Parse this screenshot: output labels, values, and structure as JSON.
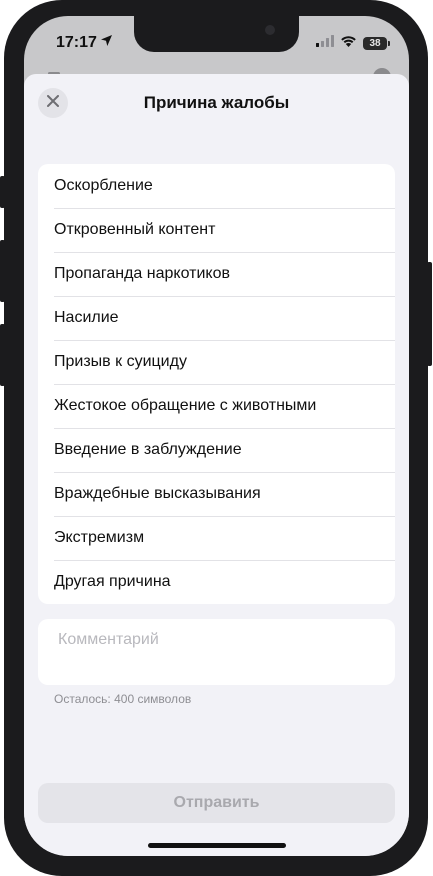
{
  "status_bar": {
    "time": "17:17",
    "battery": "38"
  },
  "sheet": {
    "title": "Причина жалобы",
    "reasons": [
      "Оскорбление",
      "Откровенный контент",
      "Пропаганда наркотиков",
      "Насилие",
      "Призыв к суициду",
      "Жестокое обращение с животными",
      "Введение в заблуждение",
      "Враждебные высказывания",
      "Экстремизм",
      "Другая причина"
    ],
    "comment_placeholder": "Комментарий",
    "comment_value": "",
    "counter": "Осталось: 400 символов",
    "submit_label": "Отправить"
  },
  "icons": {
    "close": "close-icon",
    "location": "location-arrow-icon",
    "signal": "cellular-signal-icon",
    "wifi": "wifi-icon",
    "battery": "battery-icon"
  },
  "colors": {
    "sheet_background": "#f2f2f7",
    "submit_disabled_bg": "#e4e4e9",
    "submit_disabled_text": "#a9a9ae",
    "placeholder": "#b8b8bd"
  }
}
